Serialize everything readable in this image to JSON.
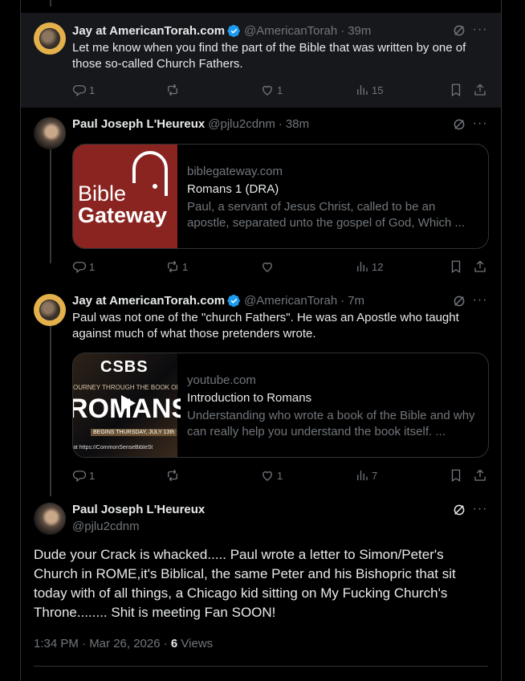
{
  "tweets": [
    {
      "name": "Jay at AmericanTorah.com",
      "handle": "@AmericanTorah",
      "time": "39m",
      "text": "Let me know when you find the part of the Bible that was written by one of those so-called Church Fathers.",
      "replies": "1",
      "retweets": "",
      "likes": "1",
      "views": "15"
    },
    {
      "name": "Paul Joseph L'Heureux",
      "handle": "@pjlu2cdnm",
      "time": "38m",
      "card": {
        "thumb_logo_line1": "Bible",
        "thumb_logo_line2": "Gateway",
        "domain": "biblegateway.com",
        "title": "Romans 1 (DRA)",
        "description": "Paul, a servant of Jesus Christ, called to be an apostle, separated unto the gospel of God, Which ..."
      },
      "replies": "1",
      "retweets": "1",
      "likes": "",
      "views": "12"
    },
    {
      "name": "Jay at AmericanTorah.com",
      "handle": "@AmericanTorah",
      "time": "7m",
      "text": "Paul was not one of the \"church Fathers\". He was an Apostle who taught against much of what those pretenders wrote.",
      "card": {
        "thumb_top": "CSBS",
        "thumb_mid": "OURNEY THROUGH THE BOOK OF",
        "thumb_big": "ROMANS",
        "thumb_line": "BEGINS THURSDAY, JULY 13th",
        "thumb_bottom": "at https://CommonSenseBibleSt",
        "domain": "youtube.com",
        "title": "Introduction to Romans",
        "description": "Understanding who wrote a book of the Bible and why can really help you understand the book itself. ..."
      },
      "replies": "1",
      "retweets": "",
      "likes": "1",
      "views": "7"
    }
  ],
  "main": {
    "name": "Paul Joseph L'Heureux",
    "handle": "@pjlu2cdnm",
    "text": "Dude your Crack is whacked..... Paul wrote a letter to Simon/Peter's Church in ROME,it's Biblical, the same Peter and his Bishopric that sit today with of all things, a Chicago kid sitting on My Fucking Church's Throne........ Shit is meeting Fan SOON!",
    "timestamp": "1:34 PM · Mar 26, 2026 · ",
    "views_count": "6",
    "views_label": " Views"
  },
  "colors": {
    "background": "#000000",
    "highlight": "#16181c",
    "text": "#e7e9ea",
    "muted": "#71767b",
    "border": "#2f3336",
    "verified": "#1d9bf0"
  },
  "icons": [
    "grok-icon",
    "more-icon",
    "reply-icon",
    "retweet-icon",
    "like-icon",
    "views-icon",
    "bookmark-icon",
    "share-icon",
    "verified-badge-icon",
    "play-icon"
  ]
}
